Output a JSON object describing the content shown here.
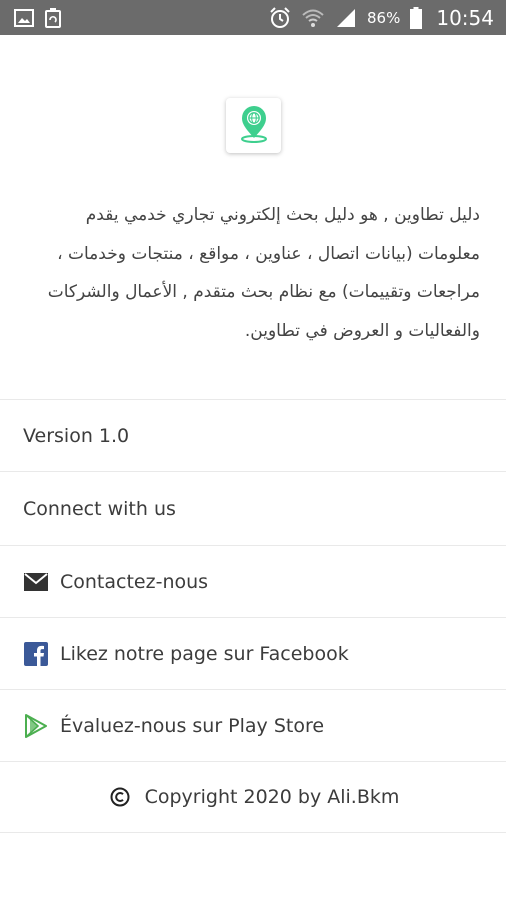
{
  "status_bar": {
    "battery_percent": "86%",
    "time": "10:54",
    "icons": [
      "image-icon",
      "recycle-icon",
      "alarm-icon",
      "wifi-icon",
      "signal-icon",
      "battery-icon"
    ]
  },
  "app": {
    "logo_icon": "globe-location-pin-icon",
    "description": "دليل تطاوين , هو دليل بحث إلكتروني تجاري خدمي يقدم معلومات (بيانات اتصال ، عناوين ، مواقع ، منتجات وخدمات ، مراجعات وتقييمات) مع نظام بحث متقدم , الأعمال والشركات والفعاليات و العروض في تطاوين."
  },
  "about": {
    "version": "Version 1.0",
    "connect_heading": "Connect with us",
    "items": [
      {
        "label": "Contactez-nous",
        "icon": "envelope-icon"
      },
      {
        "label": "Likez notre page sur Facebook",
        "icon": "facebook-icon"
      },
      {
        "label": "Évaluez-nous sur Play Store",
        "icon": "play-store-icon"
      }
    ],
    "copyright": "Copyright 2020 by Ali.Bkm",
    "copyright_icon": "copyright-icon"
  },
  "colors": {
    "status_bar": "#6b6b6b",
    "facebook_blue": "#3b5998",
    "play_green": "#4caf50",
    "logo_green": "#3ecf8e"
  }
}
